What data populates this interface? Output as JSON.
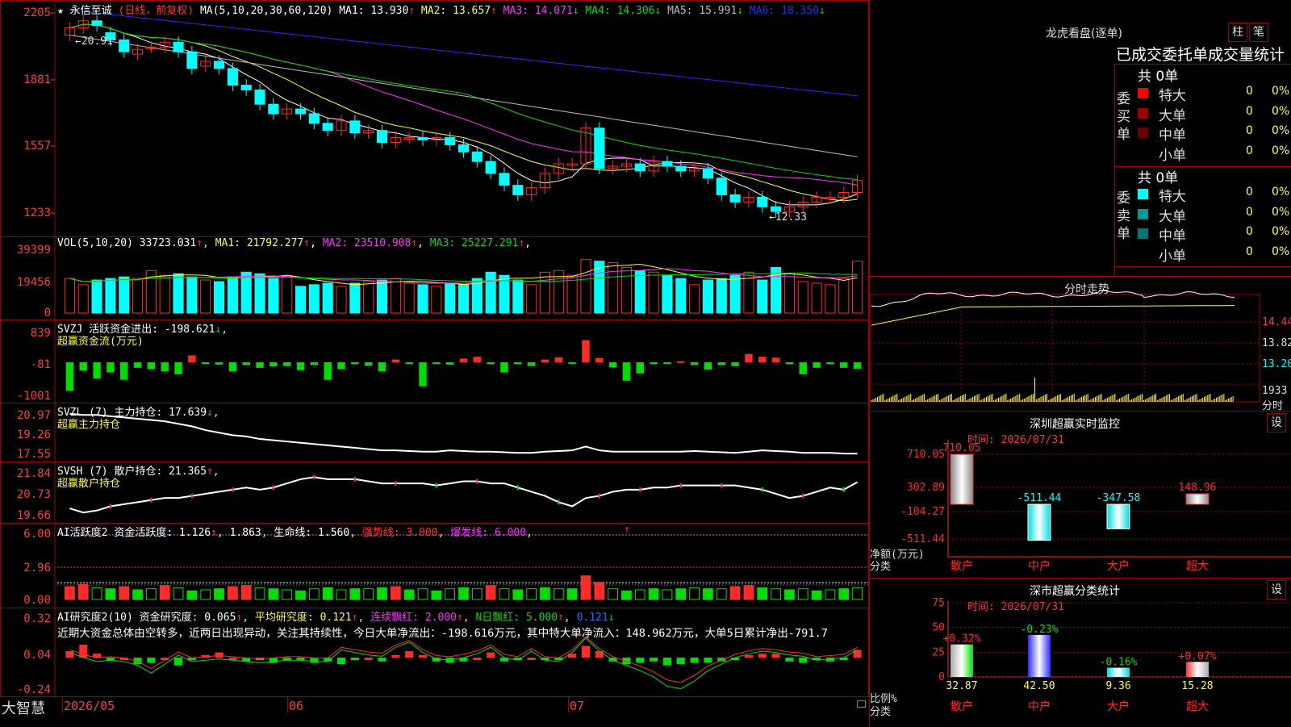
{
  "colors": {
    "up": "#ff2a2a",
    "down": "#00ffff",
    "bg": "#000000",
    "grid": "#a00000",
    "yellow": "#ffff33",
    "magenta": "#ff33ff",
    "green": "#00dd00",
    "blue": "#2a2aff",
    "white": "#ffffff",
    "gray": "#bbbbbb"
  },
  "kline": {
    "title_star": "★",
    "stock_name": "永信至诚",
    "period": "(日线，前复权)",
    "ma_label": "MA(5,10,20,30,60,120)",
    "ma": [
      {
        "label": "MA1:",
        "value": "13.930",
        "arrow": "↑",
        "color": "#ffffff"
      },
      {
        "label": "MA2:",
        "value": "13.657",
        "arrow": "↑",
        "color": "#ffff33"
      },
      {
        "label": "MA3:",
        "value": "14.071",
        "arrow": "↓",
        "color": "#ff33ff"
      },
      {
        "label": "MA4:",
        "value": "14.306",
        "arrow": "↓",
        "color": "#00dd00"
      },
      {
        "label": "MA5:",
        "value": "15.991",
        "arrow": "↓",
        "color": "#bbbbbb"
      },
      {
        "label": "MA6:",
        "value": "18.350",
        "arrow": "↓",
        "color": "#2a2aff"
      }
    ],
    "y_ticks": [
      "2205",
      "1881",
      "1557",
      "1233"
    ],
    "high_marker": "←20.91",
    "low_marker": "←12.33",
    "closes": [
      20.6,
      20.9,
      20.7,
      20.1,
      19.6,
      19.7,
      19.8,
      20.0,
      19.6,
      18.9,
      19.2,
      18.9,
      18.2,
      18.0,
      17.4,
      17.0,
      17.2,
      17.0,
      16.6,
      16.3,
      16.7,
      16.2,
      16.3,
      15.8,
      16.0,
      16.0,
      15.9,
      16.0,
      15.7,
      15.4,
      15.0,
      14.5,
      14.0,
      13.6,
      13.9,
      14.5,
      14.9,
      14.9,
      16.4,
      14.7,
      14.8,
      14.9,
      14.6,
      15.0,
      14.8,
      14.6,
      14.7,
      14.3,
      13.6,
      13.3,
      13.5,
      13.1,
      12.9,
      13.1,
      13.3,
      13.5,
      13.5,
      13.7,
      14.2
    ],
    "opens": [
      20.3,
      20.6,
      20.9,
      20.4,
      20.1,
      19.5,
      19.8,
      19.8,
      20.0,
      19.6,
      19.0,
      19.2,
      18.9,
      18.2,
      18.0,
      17.4,
      17.0,
      17.2,
      17.0,
      16.6,
      16.3,
      16.7,
      16.2,
      16.3,
      15.8,
      16.0,
      16.0,
      15.9,
      16.0,
      15.7,
      15.4,
      15.0,
      14.5,
      14.0,
      13.6,
      13.9,
      14.5,
      14.9,
      14.9,
      16.4,
      14.7,
      14.8,
      14.9,
      14.6,
      15.0,
      14.8,
      14.6,
      14.7,
      14.3,
      13.6,
      13.3,
      13.5,
      13.1,
      12.9,
      13.1,
      13.3,
      13.5,
      13.5,
      13.7
    ]
  },
  "vol": {
    "label": "VOL(5,10,20)",
    "value": "33723.031",
    "arrow": "↑",
    "ma": [
      {
        "label": "MA1:",
        "value": "21792.277",
        "arrow": "↑",
        "color": "#ffff33"
      },
      {
        "label": "MA2:",
        "value": "23510.908",
        "arrow": "↑",
        "color": "#ff33ff"
      },
      {
        "label": "MA3:",
        "value": "25227.291",
        "arrow": "↑",
        "color": "#00dd00"
      }
    ],
    "y_ticks": [
      "39399",
      "19456",
      "0"
    ],
    "bars": [
      22,
      18,
      21,
      22,
      23,
      22,
      27,
      24,
      25,
      23,
      21,
      20,
      23,
      26,
      25,
      22,
      24,
      17,
      18,
      19,
      17,
      19,
      20,
      21,
      22,
      19,
      18,
      17,
      19,
      18,
      22,
      26,
      24,
      21,
      18,
      26,
      27,
      24,
      34,
      33,
      32,
      29,
      27,
      26,
      24,
      22,
      18,
      21,
      22,
      24,
      26,
      21,
      29,
      25,
      20,
      19,
      18,
      22,
      33
    ]
  },
  "svzj": {
    "label": "SVZJ",
    "text": "活跃资金进出:",
    "value": "-198.621",
    "arrow": "↓",
    "sub": "超赢资金流(万元)",
    "y_ticks": [
      "839",
      "-81",
      "-1001"
    ],
    "bars": [
      -620,
      -180,
      -350,
      -220,
      -380,
      -120,
      -150,
      -200,
      -260,
      150,
      -30,
      -50,
      -200,
      -60,
      -120,
      -90,
      -80,
      -170,
      -60,
      -380,
      -150,
      -40,
      -70,
      -200,
      60,
      -30,
      -520,
      -30,
      -50,
      80,
      120,
      -40,
      -220,
      -40,
      -80,
      60,
      110,
      -30,
      480,
      90,
      -110,
      -400,
      -240,
      -40,
      -30,
      20,
      -60,
      -160,
      -60,
      -80,
      180,
      120,
      100,
      -40,
      -260,
      -120,
      -40,
      -120,
      -140
    ]
  },
  "svzl": {
    "label": "SVZL",
    "param": "(7)",
    "text": "主力持仓:",
    "value": "17.639",
    "arrow": "↓",
    "sub": "超赢主力持仓",
    "y_ticks": [
      "20.97",
      "19.26",
      "17.55"
    ],
    "line": [
      20.8,
      20.7,
      20.7,
      20.6,
      20.5,
      20.4,
      20.3,
      20.2,
      20.0,
      19.8,
      19.5,
      19.3,
      19.1,
      19.0,
      18.8,
      18.7,
      18.6,
      18.5,
      18.4,
      18.3,
      18.2,
      18.1,
      18.0,
      17.9,
      17.9,
      17.85,
      17.8,
      17.8,
      17.9,
      17.85,
      17.8,
      17.8,
      17.75,
      17.7,
      17.7,
      17.8,
      17.85,
      17.9,
      18.2,
      17.9,
      17.8,
      17.8,
      17.8,
      17.8,
      17.8,
      17.8,
      17.85,
      17.8,
      17.75,
      17.7,
      17.8,
      17.9,
      17.85,
      17.8,
      17.7,
      17.7,
      17.7,
      17.65,
      17.64
    ]
  },
  "svsh": {
    "label": "SVSH",
    "param": "(7)",
    "text": "散户持仓:",
    "value": "21.365",
    "arrow": "↑",
    "sub": "超赢散户持仓",
    "y_ticks": [
      "21.84",
      "20.73",
      "19.66"
    ],
    "line": [
      20.1,
      19.9,
      20.0,
      20.2,
      20.3,
      20.4,
      20.5,
      20.6,
      20.6,
      20.7,
      20.8,
      20.9,
      21.0,
      21.1,
      21.0,
      21.1,
      21.3,
      21.5,
      21.6,
      21.5,
      21.5,
      21.5,
      21.4,
      21.3,
      21.3,
      21.3,
      21.3,
      21.2,
      21.3,
      21.4,
      21.4,
      21.3,
      21.3,
      21.1,
      20.9,
      20.7,
      20.4,
      20.2,
      20.6,
      20.7,
      20.9,
      21.0,
      21.0,
      21.1,
      21.1,
      21.2,
      21.2,
      21.2,
      21.2,
      21.2,
      21.1,
      21.0,
      20.8,
      20.6,
      20.7,
      20.9,
      21.1,
      21.0,
      21.36
    ]
  },
  "ai1": {
    "label": "AI活跃度2",
    "text": "资金活跃度:",
    "value": "1.126",
    "arrow": "↑",
    "value2": "1.863",
    "arrow2": "",
    "life_label": "生命线:",
    "life_value": "1.560",
    "strong_label": "强势线:",
    "strong_value": "3.000",
    "burst_label": "爆发线:",
    "burst_value": "6.000",
    "tail_arrow": "↑",
    "y_ticks": [
      "6.00",
      "2.96",
      "0.00"
    ],
    "bars": [
      1.2,
      1.4,
      1.1,
      1.0,
      1.2,
      0.9,
      1.0,
      1.3,
      1.1,
      0.8,
      0.9,
      1.0,
      1.2,
      1.3,
      1.1,
      1.0,
      0.9,
      0.8,
      1.0,
      1.1,
      0.9,
      1.0,
      1.0,
      1.1,
      1.2,
      0.9,
      1.0,
      0.8,
      1.0,
      1.1,
      1.0,
      1.3,
      1.0,
      0.9,
      1.0,
      1.1,
      1.0,
      1.0,
      2.2,
      1.6,
      1.0,
      0.8,
      0.9,
      1.0,
      0.9,
      1.0,
      1.1,
      1.0,
      1.0,
      1.2,
      1.3,
      1.1,
      1.0,
      0.9,
      1.0,
      0.8,
      0.9,
      1.0,
      1.1
    ]
  },
  "ai2": {
    "label": "AI研究度2(10)",
    "text": "资金研究度:",
    "value": "0.065",
    "arrow": "↑",
    "avg_label": "平均研究度:",
    "avg_value": "0.121",
    "avg_arrow": "↑",
    "red_label": "连续飘红:",
    "red_value": "2.000",
    "red_arrow": "↑",
    "nred_label": "N日飘红:",
    "nred_value": "5.000",
    "nred_arrow": "↑",
    "last_value": "0.121",
    "last_arrow": "↓",
    "y_ticks": [
      "0.32",
      "0.04",
      "-0.24"
    ],
    "comment": "近期大资金总体由空转多，近两日出现异动，关注其持续性，今日大单净流出：-198.616万元，其中特大单净流入：148.962万元，大单5日累计净出-791.7",
    "bars": [
      0.05,
      0.1,
      0.03,
      -0.02,
      0.0,
      -0.05,
      -0.04,
      0.0,
      -0.06,
      -0.02,
      0.02,
      0.04,
      0.0,
      -0.03,
      -0.02,
      -0.04,
      -0.02,
      -0.01,
      -0.04,
      -0.03,
      -0.05,
      -0.02,
      0.0,
      -0.03,
      0.02,
      0.05,
      0.02,
      -0.03,
      -0.04,
      -0.03,
      0.0,
      0.04,
      -0.03,
      -0.02,
      0.0,
      -0.01,
      -0.02,
      0.03,
      0.09,
      0.05,
      -0.03,
      -0.05,
      -0.04,
      -0.03,
      -0.06,
      -0.05,
      -0.04,
      -0.04,
      -0.03,
      -0.02,
      0.02,
      0.03,
      0.03,
      -0.03,
      -0.04,
      -0.02,
      -0.03,
      -0.02,
      0.06
    ],
    "line": [
      0.04,
      0.0,
      -0.03,
      -0.02,
      -0.03,
      -0.06,
      -0.12,
      -0.05,
      0.02,
      -0.03,
      -0.02,
      -0.01,
      -0.02,
      -0.03,
      -0.04,
      -0.03,
      -0.02,
      -0.02,
      -0.03,
      -0.03,
      0.06,
      0.04,
      0.02,
      0.01,
      0.08,
      0.12,
      0.04,
      -0.01,
      -0.02,
      0.0,
      0.03,
      0.08,
      0.0,
      -0.02,
      0.05,
      -0.02,
      -0.03,
      0.04,
      0.15,
      0.05,
      -0.02,
      -0.06,
      -0.1,
      -0.15,
      -0.22,
      -0.24,
      -0.18,
      -0.1,
      -0.05,
      0.0,
      0.03,
      0.05,
      0.04,
      0.02,
      0.01,
      -0.02,
      -0.01,
      0.0,
      0.06
    ]
  },
  "xaxis": [
    "2026/05",
    "06",
    "07"
  ],
  "bottom_brand": "大智慧",
  "dragon": {
    "title": "龙虎看盘(逐单)",
    "btn1": "柱",
    "btn2": "笔",
    "subtitle": "已成交委托单成交量统计",
    "buy_label": "委买单",
    "sell_label": "委卖单",
    "buy_total": "共 0单",
    "sell_total": "共 0单",
    "buy_rows": [
      {
        "name": "特大",
        "count": "0",
        "pct": "0%",
        "color": "#ff0000"
      },
      {
        "name": "大单",
        "count": "0",
        "pct": "0%",
        "color": "#990000"
      },
      {
        "name": "中单",
        "count": "0",
        "pct": "0%",
        "color": "#660000"
      },
      {
        "name": "小单",
        "count": "0",
        "pct": "0%",
        "color": ""
      }
    ],
    "sell_rows": [
      {
        "name": "特大",
        "count": "0",
        "pct": "0%",
        "color": "#00ffff"
      },
      {
        "name": "大单",
        "count": "0",
        "pct": "0%",
        "color": "#009999"
      },
      {
        "name": "中单",
        "count": "0",
        "pct": "0%",
        "color": "#007777"
      },
      {
        "name": "小单",
        "count": "0",
        "pct": "0%",
        "color": ""
      }
    ]
  },
  "minute": {
    "title": "分时走势",
    "y_ticks": [
      "14.44",
      "13.82",
      "13.20"
    ],
    "vol_tick": "1933",
    "vol_label": "分时"
  },
  "monitor": {
    "title": "深圳超赢实时监控",
    "settings": "设",
    "time_label": "时间:",
    "time_value": "2026/07/31",
    "y_ticks": [
      "710.05",
      "302.89",
      "-104.27",
      "-511.44"
    ],
    "unit_label": "净额(万元)",
    "cat_label": "分类",
    "cats": [
      "散户",
      "中户",
      "大户",
      "超大"
    ],
    "values": [
      710.05,
      -511.44,
      -347.58,
      148.96
    ],
    "value_labels": [
      "710.05",
      "-511.44",
      "-347.58",
      "148.96"
    ]
  },
  "classify": {
    "title": "深市超赢分类统计",
    "settings": "设",
    "time_label": "时间:",
    "time_value": "2026/07/31",
    "y_ticks": [
      "75",
      "50",
      "25",
      "0"
    ],
    "ratio_label": "比例%",
    "cat_label": "分类",
    "cats": [
      "散户",
      "中户",
      "大户",
      "超大"
    ],
    "values": [
      32.87,
      42.5,
      9.36,
      15.28
    ],
    "value_labels": [
      "32.87",
      "42.50",
      "9.36",
      "15.28"
    ],
    "changes": [
      "+0.32%",
      "-0.23%",
      "-0.16%",
      "+0.07%"
    ]
  }
}
